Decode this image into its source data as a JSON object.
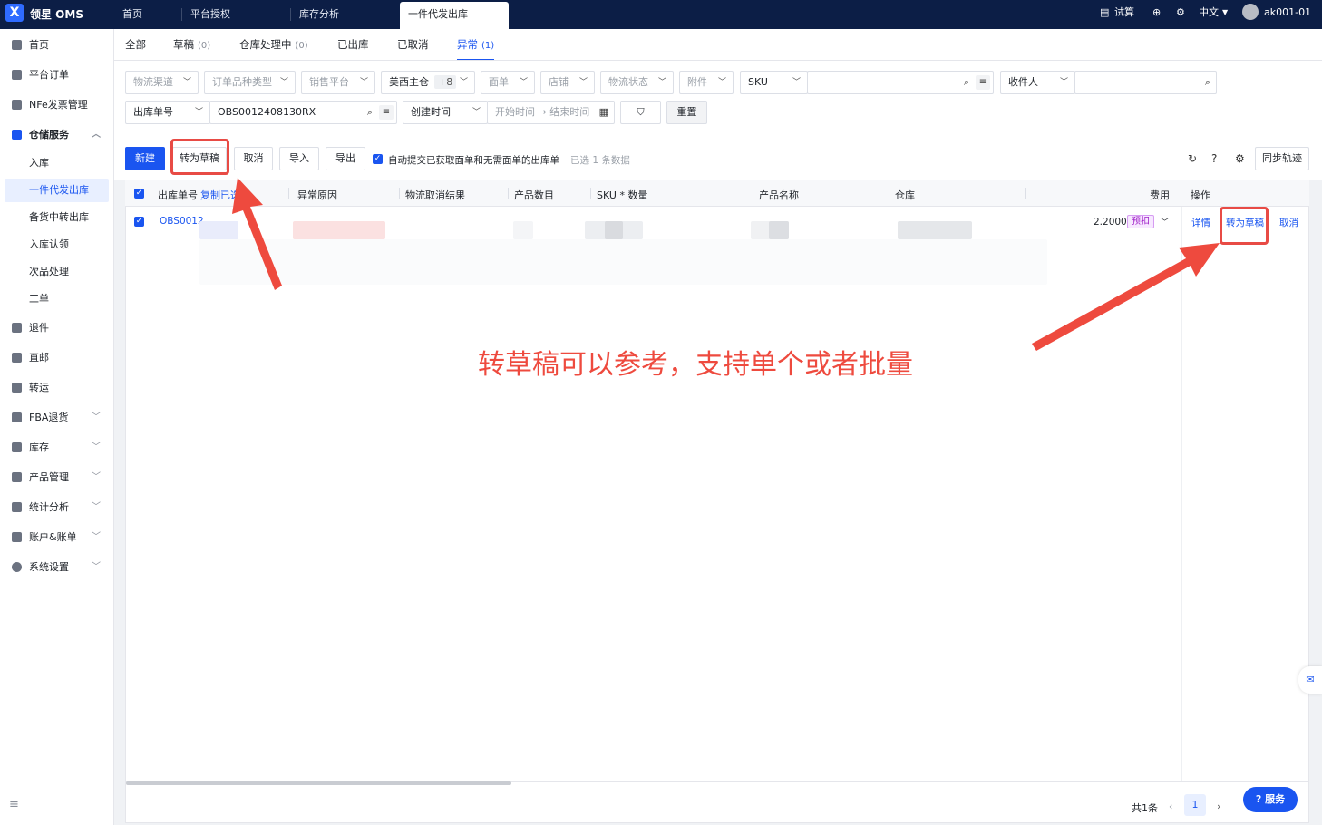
{
  "app": {
    "brand": "领星 OMS",
    "logo_letter": "X"
  },
  "top_tabs": [
    "首页",
    "平台授权",
    "库存分析",
    "一件代发出库"
  ],
  "top_right": {
    "calc_label": "试算",
    "lang": "中文",
    "user": "ak001-01"
  },
  "sidebar": {
    "items": [
      {
        "label": "首页",
        "icon": "home-icon"
      },
      {
        "label": "平台订单",
        "icon": "orders-icon"
      },
      {
        "label": "NFe发票管理",
        "icon": "invoice-icon"
      },
      {
        "label": "仓储服务",
        "icon": "warehouse-icon",
        "expanded": true
      },
      {
        "label": "退件",
        "icon": "return-icon"
      },
      {
        "label": "直邮",
        "icon": "mail-icon"
      },
      {
        "label": "转运",
        "icon": "transfer-icon"
      },
      {
        "label": "FBA退货",
        "icon": "fba-icon",
        "chevron": true
      },
      {
        "label": "库存",
        "icon": "inventory-icon",
        "chevron": true
      },
      {
        "label": "产品管理",
        "icon": "product-icon",
        "chevron": true
      },
      {
        "label": "统计分析",
        "icon": "stats-icon",
        "chevron": true
      },
      {
        "label": "账户&账单",
        "icon": "account-icon",
        "chevron": true
      },
      {
        "label": "系统设置",
        "icon": "settings-icon",
        "chevron": true
      }
    ],
    "sub_items": [
      "入库",
      "一件代发出库",
      "备货中转出库",
      "入库认领",
      "次品处理",
      "工单"
    ],
    "active_sub": "一件代发出库"
  },
  "status_tabs": [
    {
      "label": "全部",
      "count": ""
    },
    {
      "label": "草稿",
      "count": "(0)"
    },
    {
      "label": "仓库处理中",
      "count": "(0)"
    },
    {
      "label": "已出库",
      "count": ""
    },
    {
      "label": "已取消",
      "count": ""
    },
    {
      "label": "异常",
      "count": "(1)",
      "active": true
    }
  ],
  "filters": {
    "row1": [
      "物流渠道",
      "订单品种类型",
      "销售平台",
      "美西主仓",
      "面单",
      "店铺",
      "物流状态",
      "附件",
      "SKU",
      "收件人"
    ],
    "warehouse_more": "+8",
    "order_no_type": "出库单号",
    "order_no_value": "OBS0012408130RX",
    "time_type": "创建时间",
    "start_time_placeholder": "开始时间",
    "end_time_placeholder": "结束时间",
    "reset_label": "重置"
  },
  "toolbar": {
    "new_label": "新建",
    "to_draft_label": "转为草稿",
    "cancel_label": "取消",
    "import_label": "导入",
    "export_label": "导出",
    "auto_submit_label": "自动提交已获取面单和无需面单的出库单",
    "selected_text": "已选 1 条数据",
    "sync_label": "同步轨迹"
  },
  "table": {
    "columns": [
      "出库单号",
      "复制已选",
      "异常原因",
      "物流取消结果",
      "产品数目",
      "SKU * 数量",
      "产品名称",
      "仓库",
      "费用",
      "操作"
    ],
    "rows": [
      {
        "order_no": "OBS0012",
        "fee": "2.2000",
        "fee_tag": "预扣",
        "actions": [
          "详情",
          "转为草稿",
          "取消"
        ]
      }
    ]
  },
  "annotation": "转草稿可以参考，支持单个或者批量",
  "pagination": {
    "total": "共1条",
    "current_page": "1"
  },
  "service_button": "服务",
  "colors": {
    "primary": "#1a55f0",
    "topbar": "#0c1e46",
    "highlight": "#e84b45",
    "tag": "#a020c8"
  }
}
